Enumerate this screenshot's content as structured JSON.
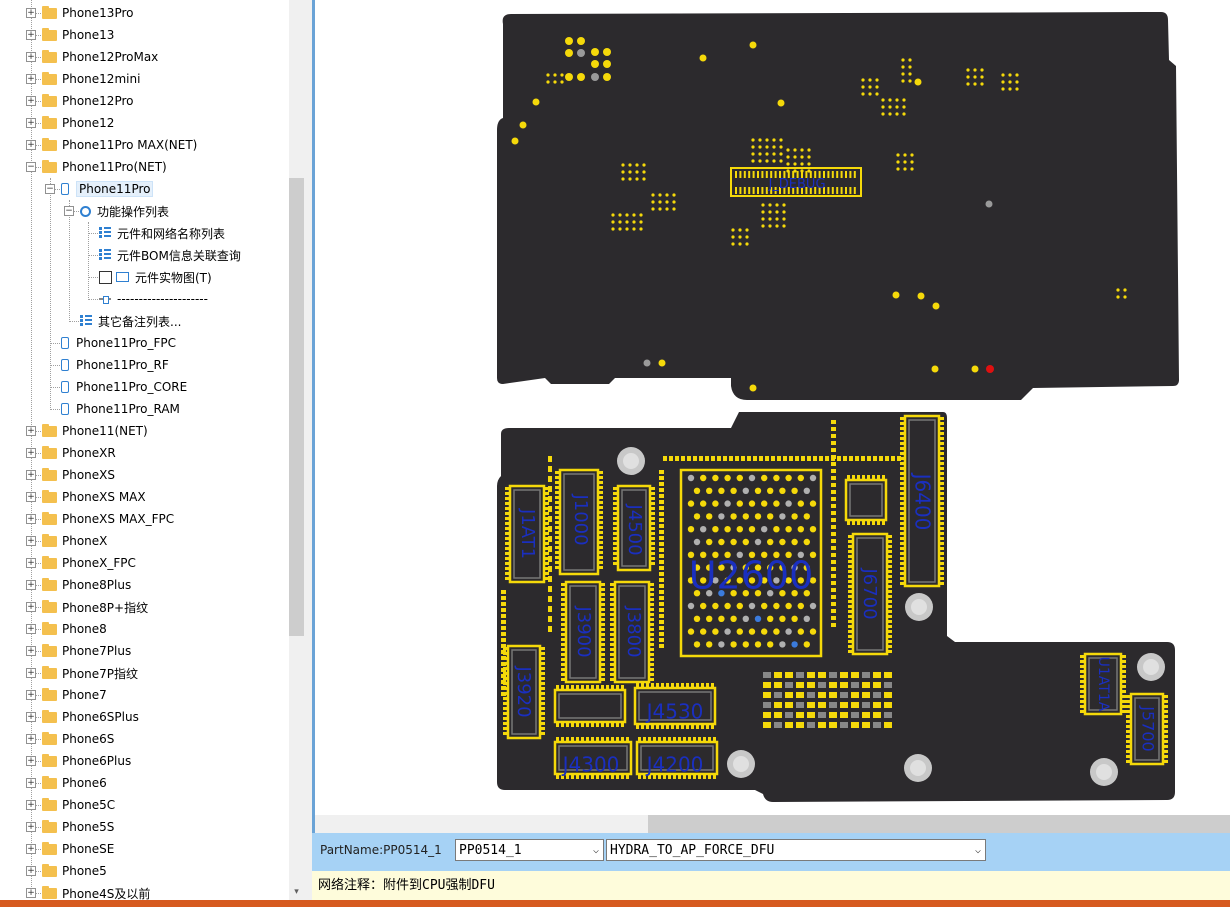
{
  "tree": {
    "items": [
      {
        "label": "Phone13Pro",
        "type": "folder",
        "level": 0,
        "expander": "+"
      },
      {
        "label": "Phone13",
        "type": "folder",
        "level": 0,
        "expander": "+"
      },
      {
        "label": "Phone12ProMax",
        "type": "folder",
        "level": 0,
        "expander": "+"
      },
      {
        "label": "Phone12mini",
        "type": "folder",
        "level": 0,
        "expander": "+"
      },
      {
        "label": "Phone12Pro",
        "type": "folder",
        "level": 0,
        "expander": "+"
      },
      {
        "label": "Phone12",
        "type": "folder",
        "level": 0,
        "expander": "+"
      },
      {
        "label": "Phone11Pro MAX(NET)",
        "type": "folder",
        "level": 0,
        "expander": "+"
      },
      {
        "label": "Phone11Pro(NET)",
        "type": "folder",
        "level": 0,
        "expander": "-"
      },
      {
        "label": "Phone11Pro",
        "type": "phone",
        "level": 1,
        "expander": "-",
        "selected": true
      },
      {
        "label": "功能操作列表",
        "type": "gear",
        "level": 2,
        "expander": "-"
      },
      {
        "label": "元件和网络名称列表",
        "type": "list",
        "level": 3
      },
      {
        "label": "元件BOM信息关联查询",
        "type": "list",
        "level": 3
      },
      {
        "label": "元件实物图(T)",
        "type": "check",
        "level": 3
      },
      {
        "label": "---------------------",
        "type": "sep",
        "level": 3
      },
      {
        "label": "其它备注列表...",
        "type": "list",
        "level": 2
      },
      {
        "label": "Phone11Pro_FPC",
        "type": "phone",
        "level": 1
      },
      {
        "label": "Phone11Pro_RF",
        "type": "phone",
        "level": 1
      },
      {
        "label": "Phone11Pro_CORE",
        "type": "phone",
        "level": 1
      },
      {
        "label": "Phone11Pro_RAM",
        "type": "phone",
        "level": 1
      },
      {
        "label": "Phone11(NET)",
        "type": "folder",
        "level": 0,
        "expander": "+"
      },
      {
        "label": "PhoneXR",
        "type": "folder",
        "level": 0,
        "expander": "+"
      },
      {
        "label": "PhoneXS",
        "type": "folder",
        "level": 0,
        "expander": "+"
      },
      {
        "label": "PhoneXS MAX",
        "type": "folder",
        "level": 0,
        "expander": "+"
      },
      {
        "label": "PhoneXS MAX_FPC",
        "type": "folder",
        "level": 0,
        "expander": "+"
      },
      {
        "label": "PhoneX",
        "type": "folder",
        "level": 0,
        "expander": "+"
      },
      {
        "label": "PhoneX_FPC",
        "type": "folder",
        "level": 0,
        "expander": "+"
      },
      {
        "label": "Phone8Plus",
        "type": "folder",
        "level": 0,
        "expander": "+"
      },
      {
        "label": "Phone8P+指纹",
        "type": "folder",
        "level": 0,
        "expander": "+"
      },
      {
        "label": "Phone8",
        "type": "folder",
        "level": 0,
        "expander": "+"
      },
      {
        "label": "Phone7Plus",
        "type": "folder",
        "level": 0,
        "expander": "+"
      },
      {
        "label": "Phone7P指纹",
        "type": "folder",
        "level": 0,
        "expander": "+"
      },
      {
        "label": "Phone7",
        "type": "folder",
        "level": 0,
        "expander": "+"
      },
      {
        "label": "Phone6SPlus",
        "type": "folder",
        "level": 0,
        "expander": "+"
      },
      {
        "label": "Phone6S",
        "type": "folder",
        "level": 0,
        "expander": "+"
      },
      {
        "label": "Phone6Plus",
        "type": "folder",
        "level": 0,
        "expander": "+"
      },
      {
        "label": "Phone6",
        "type": "folder",
        "level": 0,
        "expander": "+"
      },
      {
        "label": "Phone5C",
        "type": "folder",
        "level": 0,
        "expander": "+"
      },
      {
        "label": "Phone5S",
        "type": "folder",
        "level": 0,
        "expander": "+"
      },
      {
        "label": "PhoneSE",
        "type": "folder",
        "level": 0,
        "expander": "+"
      },
      {
        "label": "Phone5",
        "type": "folder",
        "level": 0,
        "expander": "+"
      },
      {
        "label": "Phone4S及以前",
        "type": "folder",
        "level": 0,
        "expander": "+"
      }
    ]
  },
  "board": {
    "background_color": "#2c2a2d",
    "pad_color": "#f5d90a",
    "label_color": "#1a2fbf",
    "connector_top": "J_DEBUG",
    "components": [
      "J6400",
      "U2600",
      "J1AT1",
      "J1000",
      "J4500",
      "J3900",
      "J3800",
      "J3920",
      "J4530",
      "J4300",
      "J4200",
      "J5700",
      "J6700",
      "U1AT1A"
    ]
  },
  "bottom": {
    "part_label": "PartName:PP0514_1",
    "part_value": "PP0514_1",
    "net_value": "HYDRA_TO_AP_FORCE_DFU",
    "combo_arrow": "⌵"
  },
  "note": {
    "text": "网络注释：附件到CPU强制DFU"
  },
  "icons": {
    "expander_plus": "plus-icon",
    "expander_minus": "minus-icon",
    "scroll_down": "▾"
  }
}
